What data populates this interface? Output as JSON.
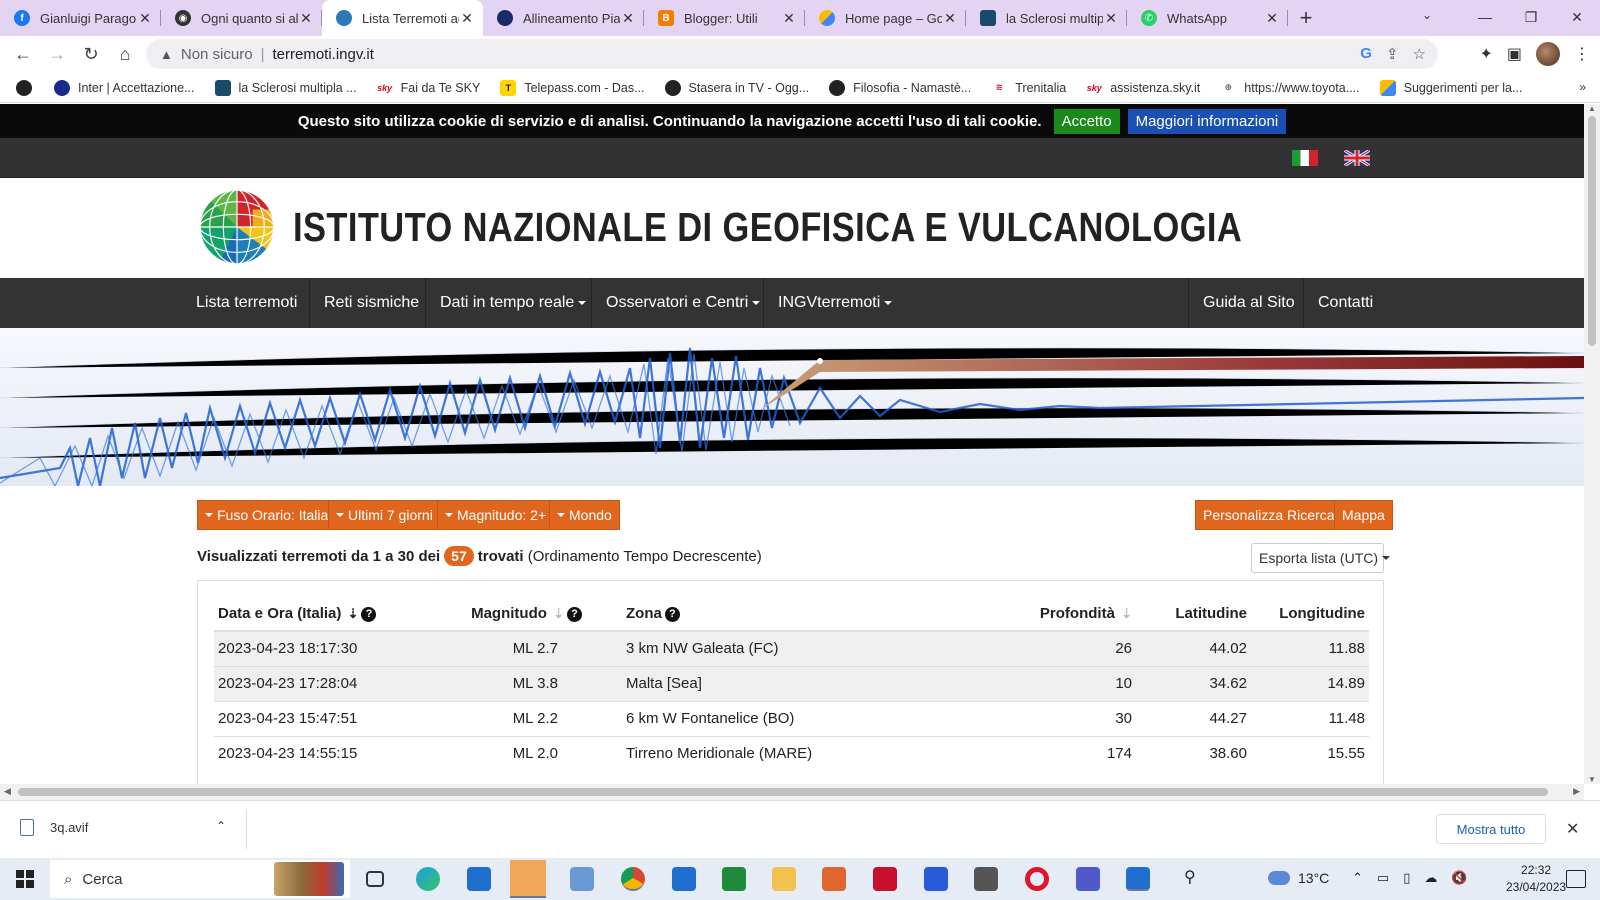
{
  "browser": {
    "tabs": [
      {
        "label": "Gianluigi Paragon",
        "icon_color": "#1877f2",
        "icon": "facebook-icon"
      },
      {
        "label": "Ogni quanto si all",
        "icon_color": "#333333",
        "icon": "eye-icon"
      },
      {
        "label": "Lista Terremoti ag",
        "icon_color": "#2b7bb9",
        "icon": "ingv-globe-icon"
      },
      {
        "label": "Allineamento Pian",
        "icon_color": "#1a2a6a",
        "icon": "planet-icon"
      },
      {
        "label": "Blogger: Utili",
        "icon_color": "#f57d00",
        "icon": "blogger-icon"
      },
      {
        "label": "Home page – Goo",
        "icon_color": "#fbbc04",
        "icon": "google-ads-icon"
      },
      {
        "label": "la Sclerosi multipl",
        "icon_color": "#1a4a6a",
        "icon": "site-icon"
      },
      {
        "label": "WhatsApp",
        "icon_color": "#25d366",
        "icon": "whatsapp-icon"
      }
    ],
    "active_tab": 2,
    "address": {
      "security_label": "Non sicuro",
      "url": "terremoti.ingv.it"
    },
    "bookmarks": [
      {
        "label": "Inter | Accettazione...",
        "icon_color": "#1a2a8a"
      },
      {
        "label": "la Sclerosi multipla ...",
        "icon_color": "#1a4a6a"
      },
      {
        "label": "Fai da Te SKY",
        "icon_color": "#e2001a"
      },
      {
        "label": "Telepass.com - Das...",
        "icon_color": "#ffd400"
      },
      {
        "label": "Stasera in TV - Ogg...",
        "icon_color": "#222222"
      },
      {
        "label": "Filosofia - Namastè...",
        "icon_color": "#222222"
      },
      {
        "label": "Trenitalia",
        "icon_color": "#c8102e"
      },
      {
        "label": "assistenza.sky.it",
        "icon_color": "#e2001a"
      },
      {
        "label": "https://www.toyota....",
        "icon_color": "#666666"
      },
      {
        "label": "Suggerimenti per la...",
        "icon_color": "#fbbc04"
      }
    ],
    "bookmarks_more": "»"
  },
  "page": {
    "cookie": {
      "text": "Questo sito utilizza cookie di servizio e di analisi. Continuando la navigazione accetti l'uso di tali cookie.",
      "accept_label": "Accetto",
      "info_label": "Maggiori informazioni"
    },
    "site_title": "ISTITUTO NAZIONALE DI GEOFISICA E VULCANOLOGIA",
    "nav": [
      {
        "label": "Lista terremoti",
        "dropdown": false
      },
      {
        "label": "Reti sismiche",
        "dropdown": false
      },
      {
        "label": "Dati in tempo reale",
        "dropdown": true
      },
      {
        "label": "Osservatori e Centri",
        "dropdown": true
      },
      {
        "label": "INGVterremoti",
        "dropdown": true
      },
      {
        "label": "Guida al Sito",
        "dropdown": false
      },
      {
        "label": "Contatti",
        "dropdown": false
      }
    ],
    "filters": {
      "timezone": "Fuso Orario: Italia",
      "period": "Ultimi 7 giorni",
      "magnitude": "Magnitudo: 2+",
      "region": "Mondo",
      "customize": "Personalizza Ricerca",
      "map": "Mappa"
    },
    "summary": {
      "prefix": "Visualizzati terremoti da 1 a 30 dei",
      "count": "57",
      "found": "trovati",
      "order": "(Ordinamento Tempo Decrescente)"
    },
    "export_label": "Esporta lista (UTC)",
    "table": {
      "headers": {
        "datetime": "Data e Ora (Italia)",
        "magnitude": "Magnitudo",
        "zone": "Zona",
        "depth": "Profondità",
        "latitude": "Latitudine",
        "longitude": "Longitudine"
      },
      "rows": [
        {
          "datetime": "2023-04-23 18:17:30",
          "magnitude": "ML 2.7",
          "zone": "3 km NW Galeata (FC)",
          "depth": "26",
          "latitude": "44.02",
          "longitude": "11.88"
        },
        {
          "datetime": "2023-04-23 17:28:04",
          "magnitude": "ML 3.8",
          "zone": "Malta [Sea]",
          "depth": "10",
          "latitude": "34.62",
          "longitude": "14.89"
        },
        {
          "datetime": "2023-04-23 15:47:51",
          "magnitude": "ML 2.2",
          "zone": "6 km W Fontanelice (BO)",
          "depth": "30",
          "latitude": "44.27",
          "longitude": "11.48"
        },
        {
          "datetime": "2023-04-23 14:55:15",
          "magnitude": "ML 2.0",
          "zone": "Tirreno Meridionale (MARE)",
          "depth": "174",
          "latitude": "38.60",
          "longitude": "15.55"
        }
      ]
    }
  },
  "downloads": {
    "file": "3q.avif",
    "show_all": "Mostra tutto"
  },
  "taskbar": {
    "search_placeholder": "Cerca",
    "temperature": "13°C",
    "time": "22:32",
    "date": "23/04/2023"
  }
}
